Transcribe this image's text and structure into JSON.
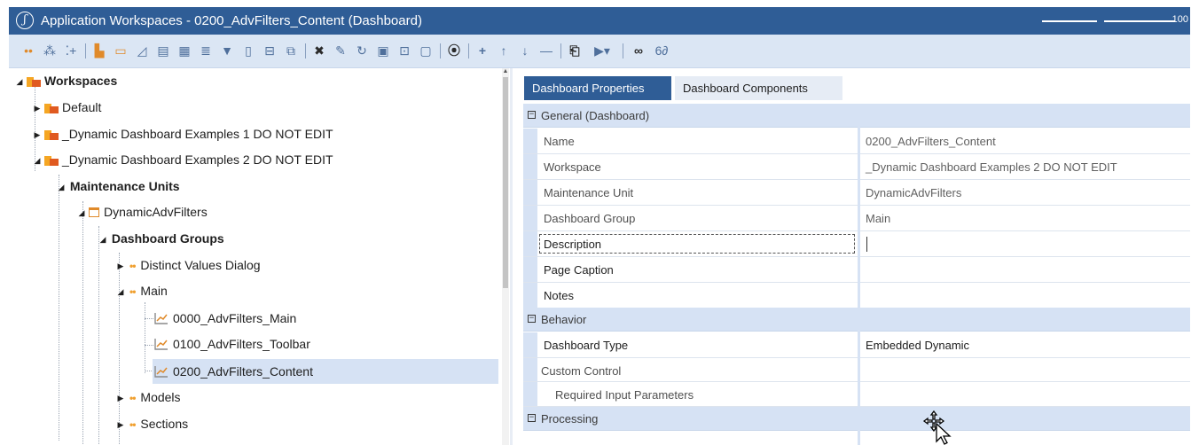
{
  "window": {
    "title": "Application Workspaces - 0200_AdvFilters_Content (Dashboard)",
    "zoom": "100"
  },
  "toolbar": {
    "icons": [
      "connect-icon",
      "hierarchy-icon",
      "tree-add-icon",
      "new-folder-icon",
      "dashboard-icon",
      "chart-icon",
      "table-icon",
      "grid-icon",
      "list-icon",
      "filter-icon",
      "document-icon",
      "component-icon",
      "copy-icon",
      "delete-icon",
      "edit-icon",
      "refresh-icon",
      "save-icon",
      "link-icon",
      "clipboard-icon",
      "search-icon",
      "add-icon",
      "up-icon",
      "down-icon",
      "remove-icon",
      "export-icon",
      "run-icon",
      "binoculars-icon",
      "object-lookup-icon"
    ],
    "glyphs": {
      "delete": "✖",
      "add": "+",
      "up": "↑",
      "down": "↓",
      "remove": "—",
      "binoculars": "👁",
      "lookup": "6∂"
    }
  },
  "tree": {
    "root": "Workspaces",
    "default": "Default",
    "examples1": "_Dynamic Dashboard Examples 1 DO NOT EDIT",
    "examples2": "_Dynamic Dashboard Examples 2 DO NOT EDIT",
    "maintenance_units": "Maintenance Units",
    "mu": "DynamicAdvFilters",
    "dashboard_groups": "Dashboard Groups",
    "group_distinct": "Distinct Values Dialog",
    "group_main": "Main",
    "dash_main": "0000_AdvFilters_Main",
    "dash_toolbar": "0100_AdvFilters_Toolbar",
    "dash_content": "0200_AdvFilters_Content",
    "models": "Models",
    "sections": "Sections"
  },
  "tabs": {
    "properties": "Dashboard Properties",
    "components": "Dashboard Components"
  },
  "grid": {
    "general": "General (Dashboard)",
    "name_label": "Name",
    "name_value": "0200_AdvFilters_Content",
    "workspace_label": "Workspace",
    "workspace_value": "_Dynamic Dashboard Examples 2 DO NOT EDIT",
    "mu_label": "Maintenance Unit",
    "mu_value": "DynamicAdvFilters",
    "group_label": "Dashboard Group",
    "group_value": "Main",
    "description_label": "Description",
    "description_value": "",
    "caption_label": "Page Caption",
    "caption_value": "",
    "notes_label": "Notes",
    "notes_value": "",
    "behavior": "Behavior",
    "type_label": "Dashboard Type",
    "type_value": "Embedded Dynamic",
    "custom_label": "Custom Control",
    "custom_value": "",
    "required_label": "Required Input Parameters",
    "required_value": "",
    "processing": "Processing",
    "toggle": "−"
  },
  "colors": {
    "accent": "#2f5d96",
    "toolbar_bg": "#dbe6f4",
    "selection": "#d6e2f4",
    "folder_orange": "#f5a623"
  }
}
